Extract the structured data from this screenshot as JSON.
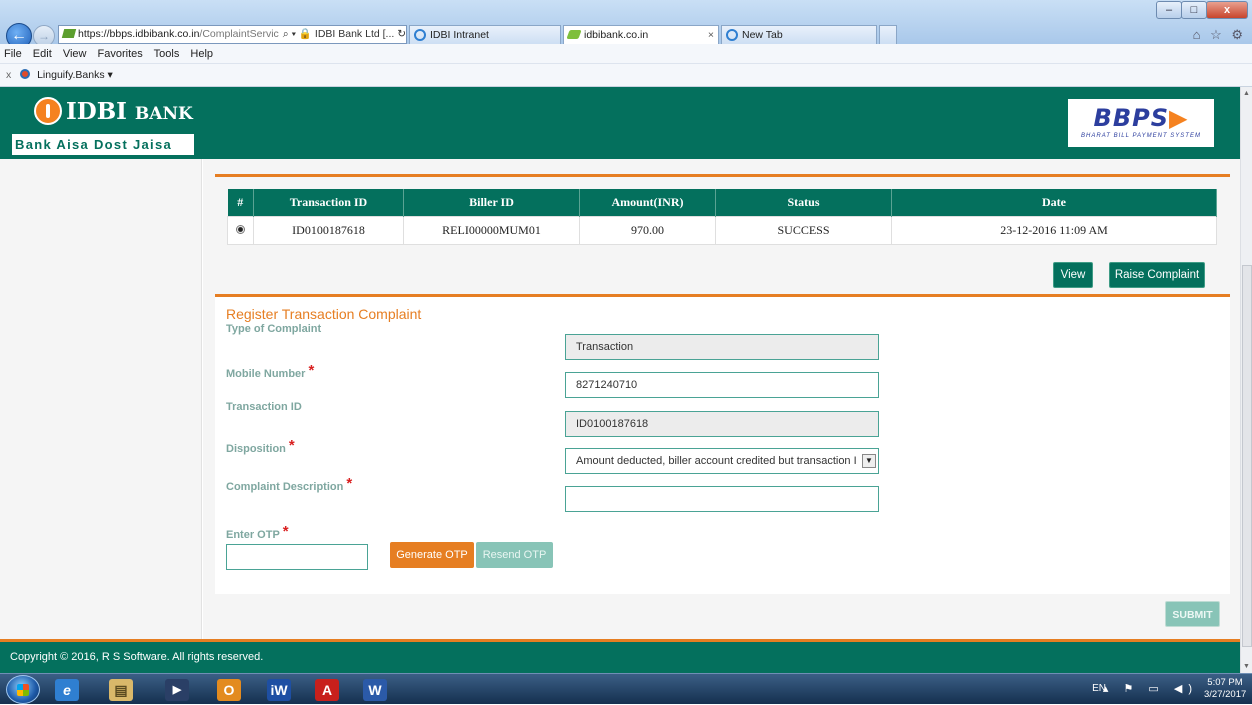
{
  "browser": {
    "address_host": "https://bbps.idbibank.co.in",
    "address_path": "/ComplaintServic",
    "address_controls": "⌕ ▾ 🔒 IDBI Bank Ltd [... ↻ ✕",
    "tabs": [
      {
        "label": "IDBI Intranet"
      },
      {
        "label": "idbibank.co.in"
      },
      {
        "label": "New Tab"
      }
    ],
    "window_controls": {
      "minimize": "–",
      "maximize": "□",
      "close": "x"
    },
    "right_icons": "⌂ ☆ ⚙"
  },
  "menubar": {
    "items": [
      "File",
      "Edit",
      "View",
      "Favorites",
      "Tools",
      "Help"
    ]
  },
  "favorites": {
    "close": "x",
    "item": "Linguify.Banks ▾"
  },
  "header": {
    "bank_name": "IDBI",
    "bank_suffix": "BANK",
    "tagline": "Bank Aisa Dost Jaisa",
    "bbps_logo": "BBPS",
    "bbps_arrow": "▶",
    "bbps_subtitle": "BHARAT BILL PAYMENT SYSTEM"
  },
  "transactions": {
    "columns": [
      "#",
      "Transaction ID",
      "Biller ID",
      "Amount(INR)",
      "Status",
      "Date"
    ],
    "rows": [
      {
        "txn_id": "ID0100187618",
        "biller_id": "RELI00000MUM01",
        "amount": "970.00",
        "status": "SUCCESS",
        "date": "23-12-2016 11:09 AM",
        "selected": true
      }
    ],
    "view_label": "View",
    "raise_label": "Raise Complaint"
  },
  "form": {
    "title": "Register Transaction Complaint",
    "type_label": "Type of Complaint",
    "type_value": "Transaction",
    "mobile_label": "Mobile Number",
    "mobile_value": "8271240710",
    "txn_label": "Transaction ID",
    "txn_value": "ID0100187618",
    "disposition_label": "Disposition",
    "disposition_value": "Amount deducted, biller account credited but transaction I",
    "description_label": "Complaint Description",
    "description_value": "",
    "otp_label": "Enter OTP",
    "required_mark": "*",
    "generate_otp": "Generate OTP",
    "resend_otp": "Resend OTP",
    "submit": "SUBMIT"
  },
  "footer": {
    "copyright": "Copyright © 2016, R S Software. All rights reserved."
  },
  "taskbar": {
    "apps": [
      "internet-explorer",
      "file-explorer",
      "media-player",
      "outlook",
      "iw-app",
      "acrobat",
      "word"
    ],
    "app_glyphs": [
      "e",
      "▤",
      "▶",
      "O",
      "iW",
      "A",
      "W"
    ],
    "lang": "EN",
    "tray_icons": "▴ ⚑ ▭ ◀)",
    "time": "5:07 PM",
    "date": "3/27/2017"
  },
  "colors": {
    "brand_green": "#04705d",
    "accent_orange": "#e67e22",
    "required_red": "#d92020"
  }
}
